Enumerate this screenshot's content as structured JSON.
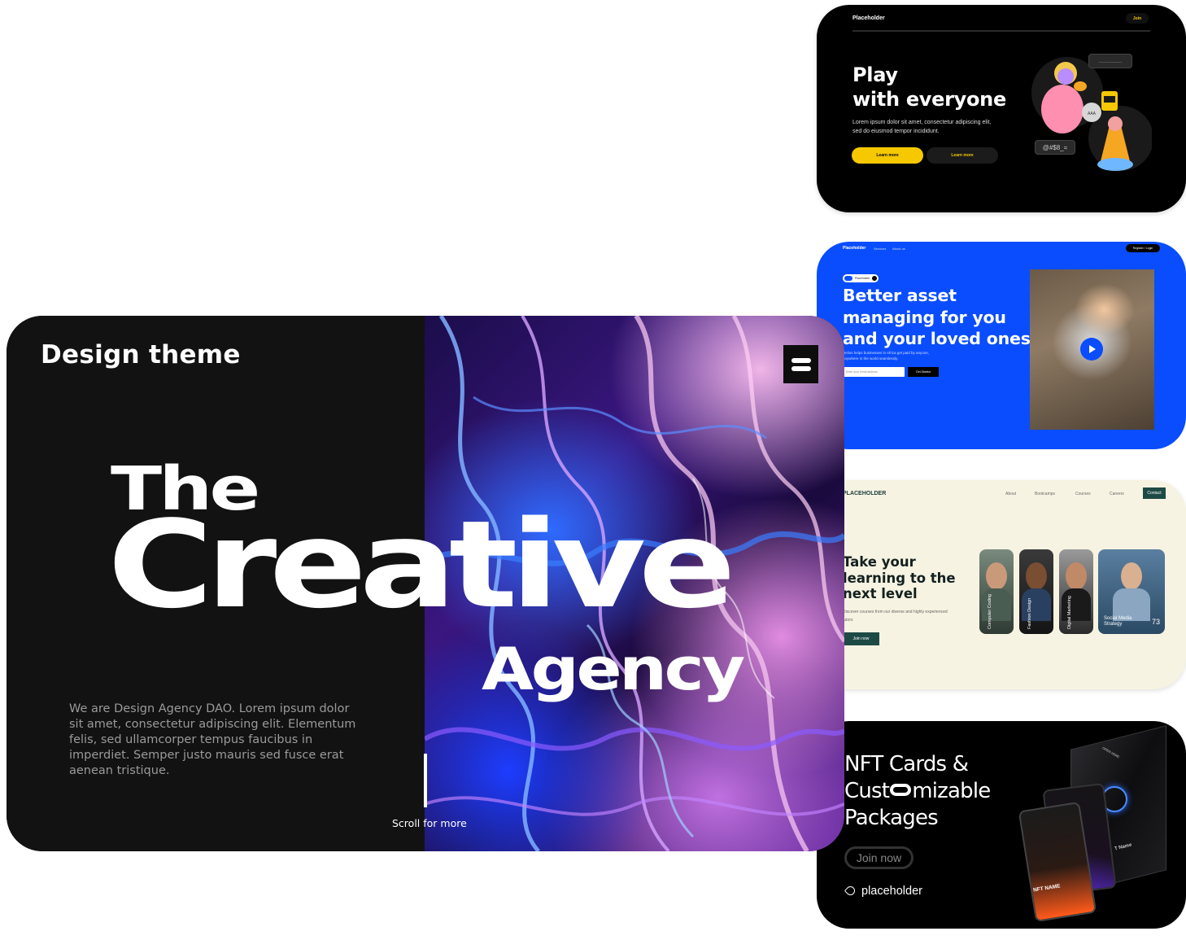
{
  "hero": {
    "theme_label": "Design theme",
    "word_the": "The",
    "word_creative": "Creative",
    "word_agency": "Agency",
    "description": "We are Design Agency DAO. Lorem ipsum dolor sit amet, consectetur adipiscing elit. Elementum felis, sed ullamcorper tempus faucibus in imperdiet. Semper justo mauris sed fusce erat aenean tristique.",
    "scroll_label": "Scroll for more",
    "logo_icon": "stacked-bars-icon"
  },
  "card_play": {
    "brand": "Placeholder",
    "join_label": "Join",
    "title_line1": "Play",
    "title_line2": "with everyone",
    "description": "Lorem ipsum dolor sit amet, consectetur adipiscing elit, sed do eiusmod tempor incididunt.",
    "primary_button": "Learn more",
    "secondary_button": "Learn more",
    "chip_top": "...............",
    "chip_badge": "AAA",
    "chip_bottom": "@#$8_=",
    "accent_color": "#f5c800"
  },
  "card_asset": {
    "brand": "Placeholder",
    "nav": [
      "Services",
      "About us"
    ],
    "register_button": "Register / Login",
    "pill_text": "Placeholder",
    "title_line1": "Better asset",
    "title_line2": "managing for you",
    "title_line3": "and your loved ones",
    "description": "Helios helps businesses in Africa get paid by anyone, anywhere in the world seamlessly.",
    "input_placeholder": "Enter your email address",
    "cta_button": "Get Started",
    "accent_color": "#0a4dff"
  },
  "card_learning": {
    "brand": "PLACEHOLDER",
    "nav": [
      "About",
      "Bootcamps",
      "Courses",
      "Careers"
    ],
    "contact_button": "Contact",
    "title_line1": "Take your",
    "title_line2": "learning to the",
    "title_line3": "next level",
    "description": "Discover courses from our diverse and highly experienced tutors",
    "cta_button": "Join now",
    "course_cards": [
      {
        "label": "Computer Coding"
      },
      {
        "label": "Fashion Design"
      },
      {
        "label": "Digital Marketing"
      },
      {
        "label": "Social Media Strategy",
        "count": "73"
      }
    ],
    "accent_color": "#1e4a45"
  },
  "card_nft": {
    "title_line1": "NFT Cards &",
    "title_line2_a": "Cust",
    "title_line2_b": "mizable",
    "title_line3": "Packages",
    "join_button": "Join now",
    "brand": "placeholder",
    "brand_icon": "tag-icon",
    "card_name_front": "NFT NAME",
    "card_name_back": "T Name",
    "box_label": "OPEN HERE"
  }
}
